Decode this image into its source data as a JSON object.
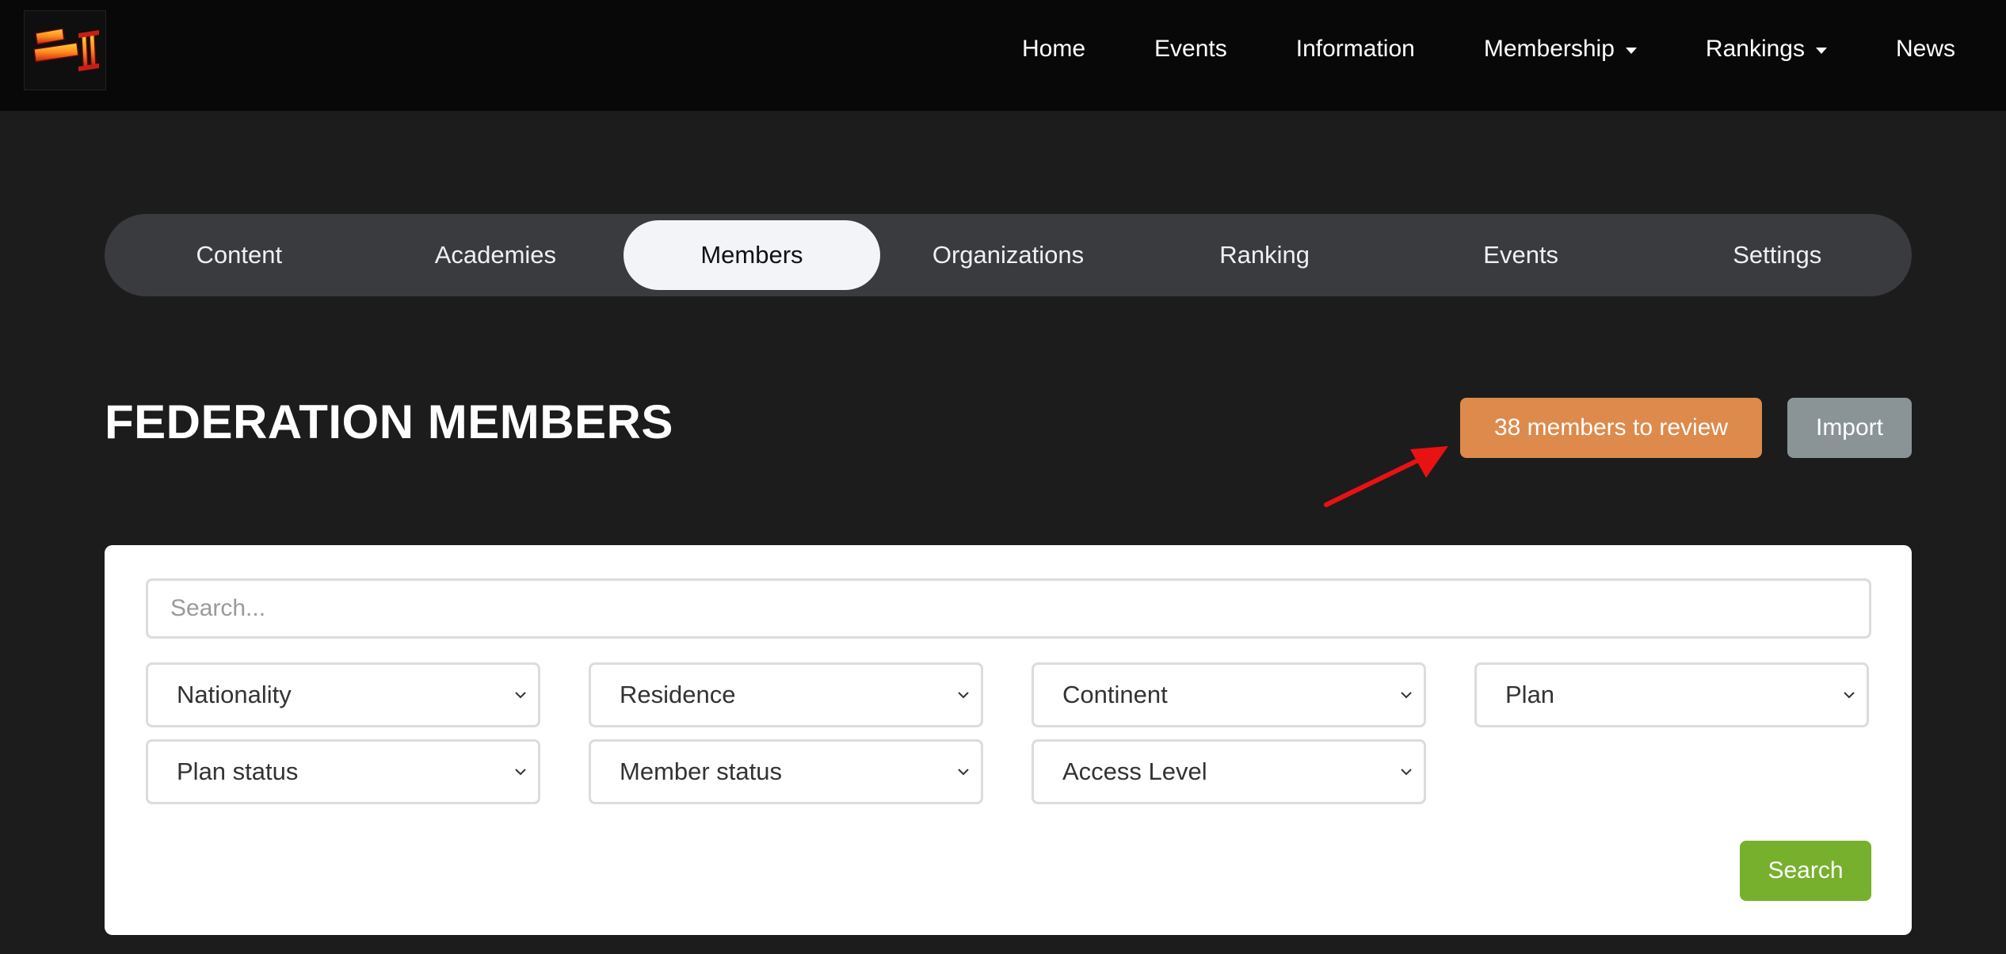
{
  "navbar": {
    "logo_alt": "Street Fighter II",
    "links": [
      {
        "label": "Home"
      },
      {
        "label": "Events"
      },
      {
        "label": "Information"
      },
      {
        "label": "Membership",
        "dropdown": true
      },
      {
        "label": "Rankings",
        "dropdown": true
      },
      {
        "label": "News"
      }
    ]
  },
  "tabs": {
    "items": [
      {
        "label": "Content"
      },
      {
        "label": "Academies"
      },
      {
        "label": "Members",
        "active": true
      },
      {
        "label": "Organizations"
      },
      {
        "label": "Ranking"
      },
      {
        "label": "Events"
      },
      {
        "label": "Settings"
      }
    ]
  },
  "header": {
    "title": "FEDERATION MEMBERS",
    "review_button": "38 members to review",
    "import_button": "Import"
  },
  "filters": {
    "search_placeholder": "Search...",
    "selects": {
      "nationality": "Nationality",
      "residence": "Residence",
      "continent": "Continent",
      "plan": "Plan",
      "plan_status": "Plan status",
      "member_status": "Member status",
      "access_level": "Access Level"
    },
    "search_button": "Search"
  },
  "colors": {
    "review_button": "#dd8a4c",
    "import_button": "#8a9497",
    "search_button": "#77b02d",
    "annotation_arrow": "#e81212"
  }
}
